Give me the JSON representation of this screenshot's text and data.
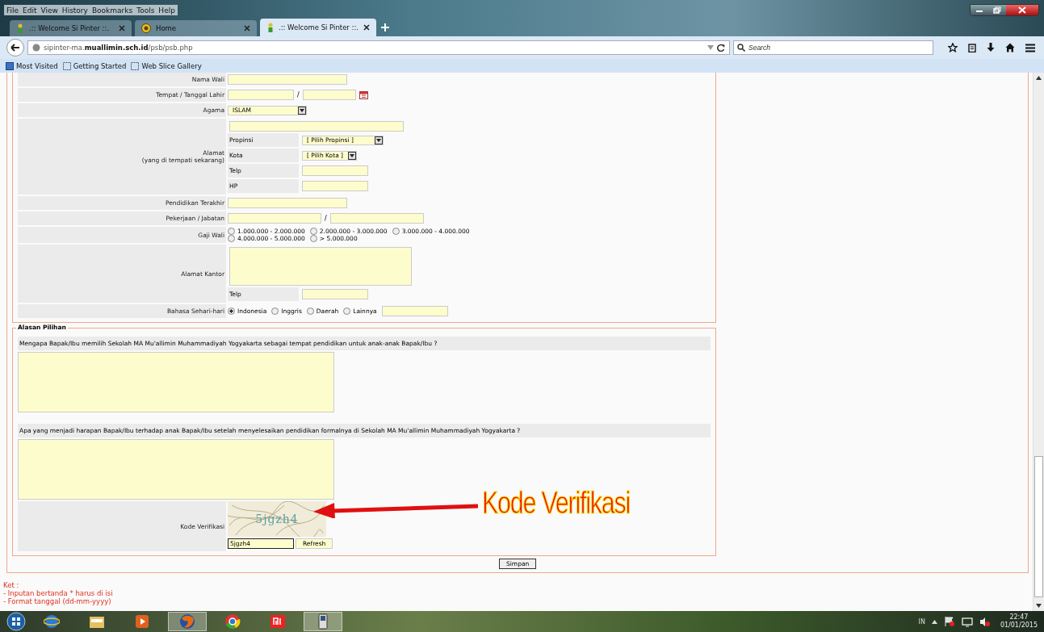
{
  "browser": {
    "menu": [
      "File",
      "Edit",
      "View",
      "History",
      "Bookmarks",
      "Tools",
      "Help"
    ],
    "tabs": [
      {
        "label": ".:: Welcome Si Pinter ::.",
        "selected": false
      },
      {
        "label": "Home",
        "selected": false
      },
      {
        "label": ".:: Welcome Si Pinter ::.",
        "selected": true
      }
    ],
    "url": {
      "prefix": "sipinter-ma.",
      "domain": "muallimin.sch.id",
      "path": "/psb/psb.php"
    },
    "search_placeholder": "Search",
    "bookmarks": [
      "Most Visited",
      "Getting Started",
      "Web Slice Gallery"
    ]
  },
  "form": {
    "rows": [
      {
        "kind": "text",
        "label": "Nama Wali"
      },
      {
        "kind": "birth",
        "label": "Tempat / Tanggal Lahir",
        "separator": "/"
      },
      {
        "kind": "select",
        "label": "Agama",
        "value": "ISLAM"
      },
      {
        "kind": "address",
        "label": "Alamat",
        "sublabel": "(yang di tempati sekarang)",
        "subrows": [
          {
            "kind": "select",
            "label": "Propinsi",
            "value": "[ Pilih Propinsi ]"
          },
          {
            "kind": "select",
            "label": "Kota",
            "value": "[ Pilih Kota ]"
          },
          {
            "kind": "text",
            "label": "Telp"
          },
          {
            "kind": "text",
            "label": "HP"
          }
        ]
      },
      {
        "kind": "text",
        "label": "Pendidikan Terakhir"
      },
      {
        "kind": "pair",
        "label": "Pekerjaan / Jabatan",
        "separator": "/"
      },
      {
        "kind": "radio",
        "label": "Gaji Wali",
        "options": [
          {
            "label": "1.000.000 - 2.000.000",
            "selected": false
          },
          {
            "label": "2.000.000 - 3.000.000",
            "selected": false
          },
          {
            "label": "3.000.000 - 4.000.000",
            "selected": false
          },
          {
            "label": "4.000.000 - 5.000.000",
            "selected": false
          },
          {
            "label": "> 5.000.000",
            "selected": false
          }
        ]
      },
      {
        "kind": "textarea",
        "label": "Alamat Kantor",
        "subrows": [
          {
            "kind": "text",
            "label": "Telp"
          }
        ]
      },
      {
        "kind": "radio_other",
        "label": "Bahasa Sehari-hari",
        "options": [
          {
            "label": "Indonesia",
            "selected": true
          },
          {
            "label": "Inggris",
            "selected": false
          },
          {
            "label": "Daerah",
            "selected": false
          },
          {
            "label": "Lainnya",
            "selected": false
          }
        ]
      }
    ]
  },
  "alasan": {
    "legend": "Alasan Pilihan",
    "questions": [
      "Mengapa Bapak/Ibu memilih Sekolah MA Mu'allimin Muhammadiyah Yogyakarta sebagai tempat pendidikan untuk anak-anak Bapak/Ibu ?",
      "Apa yang menjadi harapan Bapak/Ibu terhadap anak Bapak/Ibu setelah menyelesaikan pendidikan formalnya di Sekolah MA Mu'allimin Muhammadiyah Yogyakarta ?"
    ],
    "captcha": {
      "label": "Kode Verifikasi",
      "image_text": "5jgzh4",
      "value": "5jgzh4",
      "refresh": "Refresh"
    }
  },
  "submit": "Simpan",
  "notes": [
    "Ket  :",
    "- Inputan bertanda * harus di isi",
    "- Format tanggal (dd-mm-yyyy)"
  ],
  "annotation": "Kode Verifikasi",
  "taskbar": {
    "language": "IN",
    "time": "22:47",
    "date": "01/01/2015"
  }
}
